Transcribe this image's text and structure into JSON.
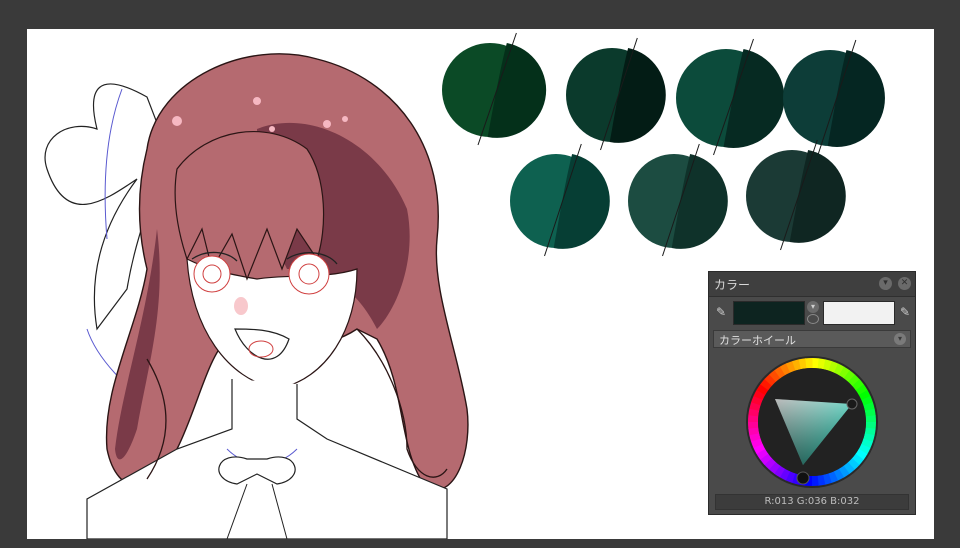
{
  "swatches": [
    {
      "color": "#0b4a26",
      "dark": "#04301a"
    },
    {
      "color": "#0b3a2c",
      "dark": "#031c15"
    },
    {
      "color": "#0c4b3b",
      "dark": "#062a22"
    },
    {
      "color": "#0d3d38",
      "dark": "#052622"
    },
    {
      "color": "#0e6150",
      "dark": "#063e34"
    },
    {
      "color": "#1c4c41",
      "dark": "#0f322a"
    },
    {
      "color": "#1b3a35",
      "dark": "#0f2622"
    }
  ],
  "color_panel": {
    "title": "カラー",
    "tab_label": "カラーホイール",
    "main_color": "#0d2420",
    "sub_color": "#f2f2f2",
    "rgb_readout": "R:013 G:036 B:032"
  },
  "colors": {
    "background": "#3a3a3a",
    "canvas": "#ffffff",
    "hair": "#b56a70",
    "hair_shadow": "#7a3a48",
    "panel": "#4a4a4a"
  }
}
